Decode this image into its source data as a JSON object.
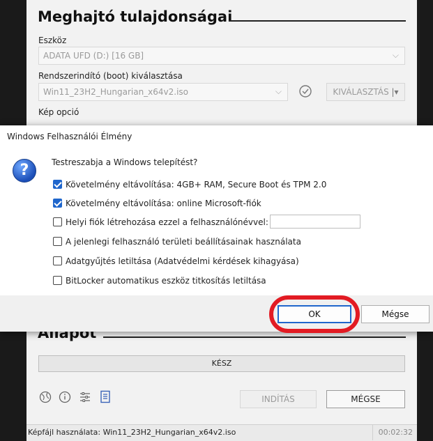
{
  "rufus": {
    "drive_section_title": "Meghajtó tulajdonságai",
    "device_label": "Eszköz",
    "device_value": "ADATA UFD (D:) [16 GB]",
    "boot_label": "Rendszerindító (boot) kiválasztása",
    "boot_value": "Win11_23H2_Hungarian_x64v2.iso",
    "select_button": "KIVÁLASZTÁS",
    "image_option_label": "Kép opció",
    "status_section_title": "Állapot",
    "progress_text": "KÉSZ",
    "progress_value": 1.0,
    "start_button": "INDÍTÁS",
    "cancel_button": "MÉGSE",
    "status_text": "Képfájl használata: Win11_23H2_Hungarian_x64v2.iso",
    "timer": "00:02:32",
    "icons": [
      "globe-icon",
      "info-icon",
      "settings-sliders-icon",
      "log-icon"
    ]
  },
  "dialog": {
    "title": "Windows Felhasználói Élmény",
    "question": "Testreszabja a Windows telepítést?",
    "options": [
      {
        "label": "Követelmény eltávolítása: 4GB+ RAM, Secure Boot és TPM 2.0",
        "checked": true
      },
      {
        "label": "Követelmény eltávolítása: online Microsoft-fiók",
        "checked": true
      },
      {
        "label": "Helyi fiók létrehozása ezzel a felhasználónévvel:",
        "checked": false
      },
      {
        "label": "A jelenlegi felhasználó területi beállításainak használata",
        "checked": false
      },
      {
        "label": "Adatgyűjtés letiltása (Adatvédelmi kérdések kihagyása)",
        "checked": false
      },
      {
        "label": "BitLocker automatikus eszköz titkosítás letiltása",
        "checked": false
      }
    ],
    "username_value": "",
    "ok_button": "OK",
    "cancel_button": "Mégse"
  },
  "colors": {
    "accent": "#1f66cc",
    "highlight": "#e21b23"
  }
}
